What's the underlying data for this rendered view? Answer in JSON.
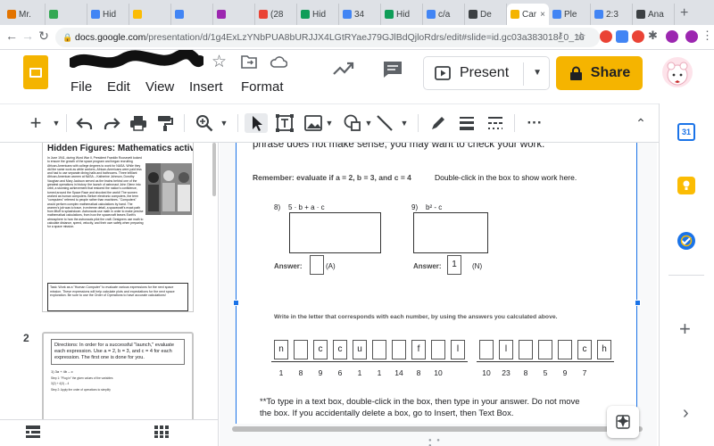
{
  "browser": {
    "tabs": [
      {
        "label": "Mr.",
        "color": "#e37400"
      },
      {
        "label": "",
        "color": "#34a853"
      },
      {
        "label": "Hid",
        "color": "#4285f4"
      },
      {
        "label": "",
        "color": "#fbbc04"
      },
      {
        "label": "",
        "color": "#4285f4"
      },
      {
        "label": "",
        "color": "#9c27b0"
      },
      {
        "label": "(28",
        "color": "#ea4335"
      },
      {
        "label": "Hid",
        "color": "#0f9d58"
      },
      {
        "label": "34",
        "color": "#4285f4"
      },
      {
        "label": "Hid",
        "color": "#0f9d58"
      },
      {
        "label": "c/a",
        "color": "#4285f4"
      },
      {
        "label": "De",
        "color": "#3c4043"
      },
      {
        "label": "Car",
        "color": "#f4b400",
        "active": true
      },
      {
        "label": "Ple",
        "color": "#4285f4"
      },
      {
        "label": "2:3",
        "color": "#4285f4"
      },
      {
        "label": "Ana",
        "color": "#3c4043"
      }
    ],
    "new_tab_symbol": "+",
    "url_domain": "docs.google.com",
    "url_path": "/presentation/d/1g4ExLzYNbPUA8bURJJX4LGtRYaeJ79GJlBdQjloRdrs/edit#slide=id.gc03a383018_0_16"
  },
  "app": {
    "menu": [
      "File",
      "Edit",
      "View",
      "Insert",
      "Format"
    ],
    "present_label": "Present",
    "share_label": "Share"
  },
  "filmstrip": {
    "slide1": {
      "title": "Hidden Figures: Mathematics activity",
      "body": "In June 1941, during Word War II, President Franklin Roosevelt looked to ensure the growth of the space program and began recruiting African-Americans with college degrees to work for NASA. While they did the same work as white workers, African-Americans were paid less and had to use separate dining halls and bathrooms. Three brilliant African-American women at NASA – Katherine Johnson, Dorothy Vaughan and Mary Jackson served as the brains behind one of the greatest operations in history: the launch of astronaut John Glenn into orbit, a stunning achievement that restored the nation's confidence, turned around the Space Race and shocked the world! The women worked as human computers. Before electronic computers, the term \"computers\" referred to people rather than machines. \"Computers\" would perform complex mathematical calculations by hand. The women's job was to trace, in extreme detail, a spacecraft's exact path from liftoff to splashdown. Astronauts use math in order to make precise mathematical calculations, from how the spacecraft leaves Earth's atmosphere to how the astronauts pilot the craft. Designers use math to calculate distance, speed, velocity, and their own safety when preparing for a space mission.",
      "task": "Task: Work as a \"Human Computer\" to evaluate various expressions for the next space mission. These expressions will help calculate plots and expectations for the next space exploration. Be sure to use the Order of Operations to have accurate calculations!"
    },
    "slide2_number": "2",
    "slide2": {
      "directions": "Directions: In order for a successful \"launch,\" evaluate each expression. Use a = 2, b = 3, and c = 4 for each expression. The first one is done for you.",
      "line1": "1)    3a + 4b – c",
      "line2": "Step 1: \"Plug in\" the given values of the variables",
      "line3": "3(2) + 4(3) – 4",
      "line4": "Step 2: Apply the order of operations to simplify"
    }
  },
  "slide": {
    "top_text": "phrase does not make sense, you may want to check your work.",
    "remember": "Remember:  evaluate if a = 2, b = 3, and c = 4",
    "double_click": "Double-click in the box to show work here.",
    "problem8_num": "8)",
    "problem8_expr": "5 · b + a · c",
    "problem9_num": "9)",
    "problem9_expr": "b² - c",
    "answer_label": "Answer:",
    "answer8_value": "",
    "answer8_letter": "(A)",
    "answer9_value": "1",
    "answer9_letter": "(N)",
    "instruction": "Write in the letter that corresponds with each number, by using the answers you calculated above.",
    "letters": [
      "n",
      "",
      "c",
      "c",
      "u",
      "",
      "",
      "f",
      "",
      "l",
      "",
      "l",
      "",
      "",
      "",
      "c",
      "h"
    ],
    "numbers": [
      "1",
      "8",
      "9",
      "6",
      "1",
      "1",
      "14",
      "8",
      "10",
      "",
      "10",
      "23",
      "8",
      "5",
      "9",
      "7"
    ],
    "footer": "**To type in a text box, double-click in the box, then type in your answer.  Do not move the box.  If you accidentally delete a box, go to Insert, then Text Box."
  },
  "side_panel": {
    "calendar_day": "31",
    "add_symbol": "+",
    "expand_symbol": "›"
  }
}
